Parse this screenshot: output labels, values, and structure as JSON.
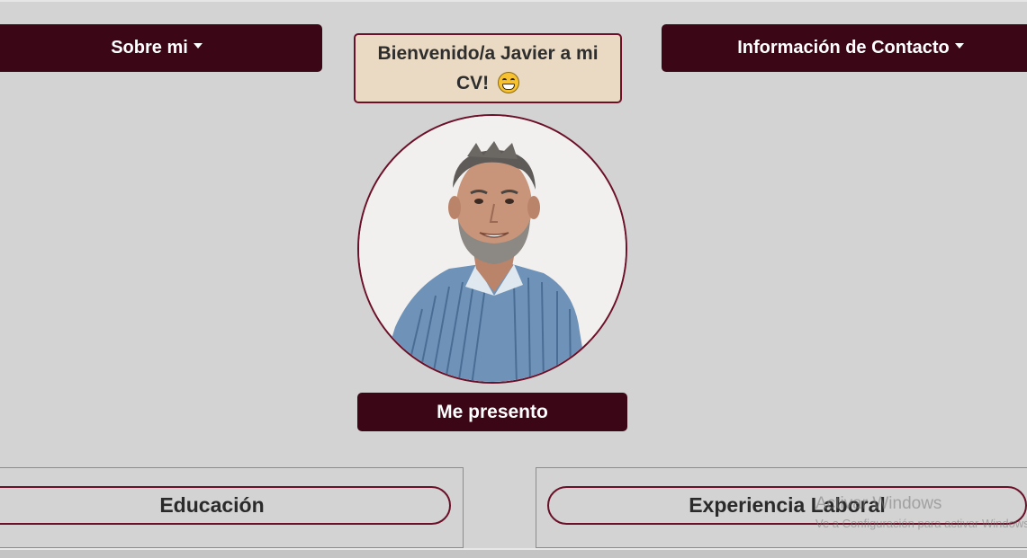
{
  "nav": {
    "about_label": "Sobre mi",
    "contact_label": "Información de Contacto"
  },
  "welcome": {
    "text": "Bienvenido/a Javier a mi CV!",
    "emoji": "grinning-face-icon"
  },
  "profile": {
    "photo_alt": "Javier",
    "present_label": "Me presento"
  },
  "sections": {
    "education_label": "Educación",
    "experience_label": "Experiencia Laboral"
  },
  "watermark": {
    "title": "Activar Windows",
    "subtitle": "Ve a Configuración para activar Windows."
  },
  "colors": {
    "primary": "#3b0616",
    "accent_border": "#6b1028",
    "welcome_bg": "#ebdac3",
    "page_bg": "#d3d3d3"
  }
}
